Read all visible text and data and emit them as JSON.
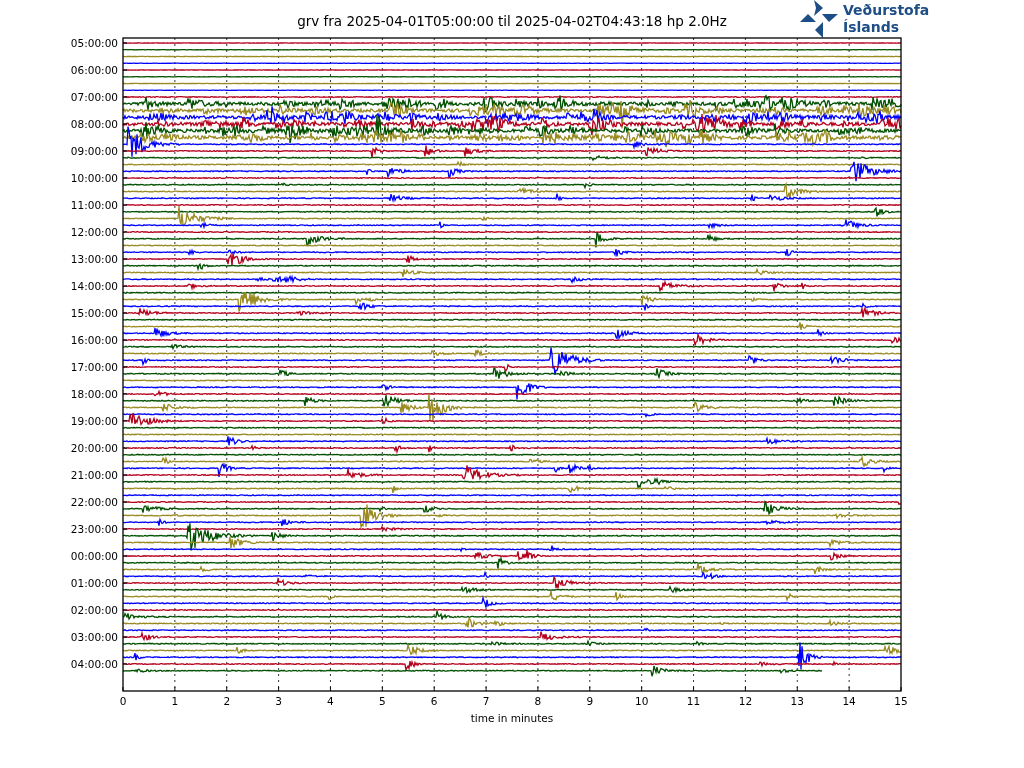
{
  "title": "grv fra 2025-04-01T05:00:00 til 2025-04-02T04:43:18 hp 2.0Hz",
  "logo": {
    "line_1": "Veðurstofa",
    "line_2": "Íslands"
  },
  "y_labels": [
    "05:00:00",
    "06:00:00",
    "07:00:00",
    "08:00:00",
    "09:00:00",
    "10:00:00",
    "11:00:00",
    "12:00:00",
    "13:00:00",
    "14:00:00",
    "15:00:00",
    "16:00:00",
    "17:00:00",
    "18:00:00",
    "19:00:00",
    "20:00:00",
    "21:00:00",
    "22:00:00",
    "23:00:00",
    "00:00:00",
    "01:00:00",
    "02:00:00",
    "03:00:00",
    "04:00:00"
  ],
  "x_ticks": [
    "0",
    "1",
    "2",
    "3",
    "4",
    "5",
    "6",
    "7",
    "8",
    "9",
    "10",
    "11",
    "12",
    "13",
    "14",
    "15"
  ],
  "xlabel": "time in minutes"
}
